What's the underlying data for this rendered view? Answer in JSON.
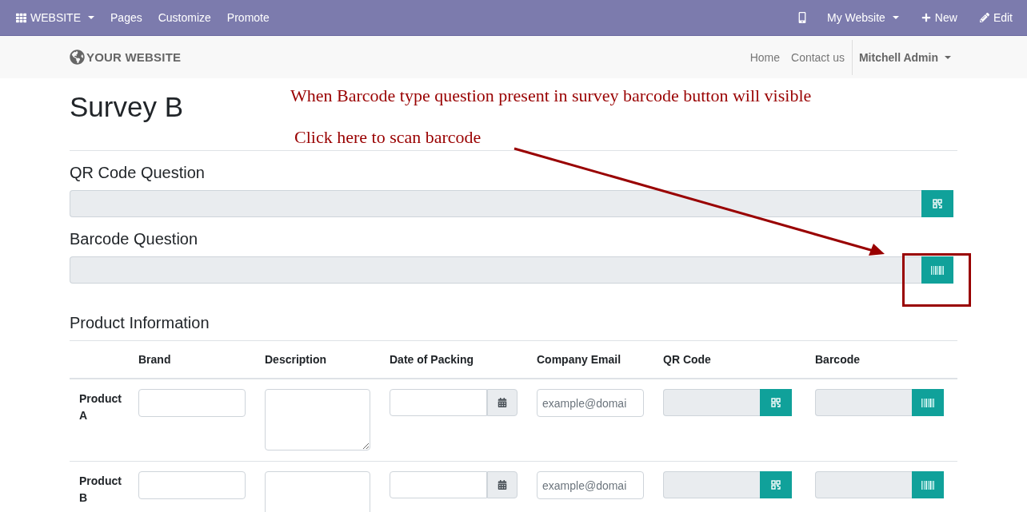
{
  "top_bar": {
    "apps_menu": "WEBSITE",
    "items": [
      "Pages",
      "Customize",
      "Promote"
    ],
    "website_menu": "My Website",
    "new_label": "New",
    "edit_label": "Edit"
  },
  "header": {
    "logo": "YOUR WEBSITE",
    "links": [
      "Home",
      "Contact us"
    ],
    "user": "Mitchell Admin"
  },
  "survey": {
    "title": "Survey B",
    "questions": [
      {
        "label": "QR Code Question",
        "kind": "qr"
      },
      {
        "label": "Barcode Question",
        "kind": "barcode"
      }
    ],
    "matrix": {
      "title": "Product Information",
      "columns": [
        {
          "label": "Brand",
          "kind": "text"
        },
        {
          "label": "Description",
          "kind": "textarea"
        },
        {
          "label": "Date of Packing",
          "kind": "date"
        },
        {
          "label": "Company Email",
          "kind": "email"
        },
        {
          "label": "QR Code",
          "kind": "qr"
        },
        {
          "label": "Barcode",
          "kind": "barcode"
        }
      ],
      "rows": [
        {
          "label": "Product A",
          "email_placeholder": "example@domai"
        },
        {
          "label": "Product B",
          "email_placeholder": "example@domai"
        }
      ]
    }
  },
  "annotations": {
    "note": "When Barcode type question present in survey barcode button will visible",
    "callout": "Click here to scan barcode"
  }
}
